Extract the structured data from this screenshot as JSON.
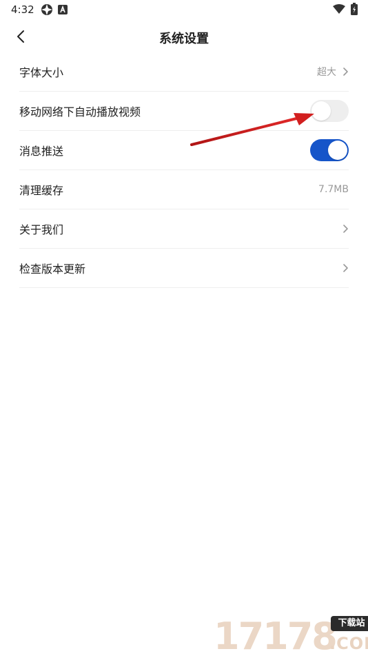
{
  "status_bar": {
    "time": "4:32",
    "icons": [
      "vpn-icon",
      "a-icon",
      "wifi-icon",
      "battery-icon"
    ]
  },
  "header": {
    "title": "系统设置",
    "back_icon": "chevron-left-icon"
  },
  "settings": {
    "font_size": {
      "label": "字体大小",
      "value": "超大"
    },
    "autoplay": {
      "label": "移动网络下自动播放视频",
      "enabled": false
    },
    "push": {
      "label": "消息推送",
      "enabled": true
    },
    "cache": {
      "label": "清理缓存",
      "value": "7.7MB"
    },
    "about": {
      "label": "关于我们"
    },
    "update": {
      "label": "检查版本更新"
    }
  },
  "colors": {
    "accent": "#1655c9",
    "toggle_off": "#eeeeee",
    "annotation_arrow": "#d21f1f"
  },
  "watermark": {
    "number": "17178",
    "badge": "下载站",
    "suffix": ".COM"
  }
}
